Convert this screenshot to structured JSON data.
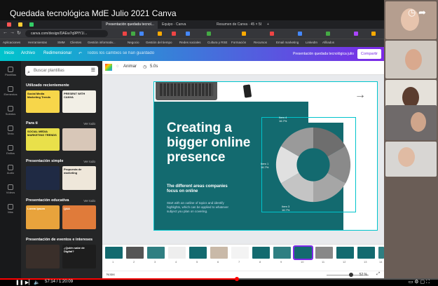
{
  "video": {
    "title": "Quedada tecnológica MdE Julio 2021 Canva",
    "time": "57:14 / 1:20:09",
    "progress_percent": 54
  },
  "browser": {
    "tabs": [
      "Presentación quedada tecnol...",
      "Equipo · Canva",
      "Resumen de Canva · 45 × 58 ·",
      "+"
    ],
    "url": "canva.com/design/DAEw7q9PfY1/...",
    "bookmarks": [
      "Aplicaciones",
      "Herramientas",
      "SMM",
      "Clientes",
      "Gestión informativ...",
      "Negocio",
      "Gestión del tiempo",
      "Redes sociales",
      "Cultura y RSE",
      "Formación",
      "Recursos",
      "Email marketing",
      "LinkedIn",
      "Afiliados"
    ]
  },
  "canva": {
    "header": {
      "home": "Inicio",
      "file": "Archivo",
      "resize": "Redimensionar",
      "saved": "Todos los cambios se han guardado",
      "doc_title": "Presentación quedada tecnológica julio",
      "share": "Compartir"
    },
    "sidebar": [
      {
        "label": "Plantillas",
        "icon": "template-icon"
      },
      {
        "label": "Elementos",
        "icon": "elements-icon"
      },
      {
        "label": "Subidos",
        "icon": "upload-icon"
      },
      {
        "label": "Texto",
        "icon": "text-icon"
      },
      {
        "label": "Estilos",
        "icon": "styles-icon"
      },
      {
        "label": "Audio",
        "icon": "audio-icon"
      },
      {
        "label": "Vídeos",
        "icon": "video-icon"
      },
      {
        "label": "Más",
        "icon": "more-icon"
      }
    ],
    "panel": {
      "search_placeholder": "Buscar plantillas",
      "see_all": "Ver todo",
      "sections": [
        {
          "title": "Utilizado recientemente",
          "thumbs": [
            "Social Media Marketing Trends",
            "PRESENT WITH CANVA"
          ]
        },
        {
          "title": "Para ti",
          "thumbs": [
            "SOCIAL MEDIA MARKETING TRENDS",
            ""
          ]
        },
        {
          "title": "Presentación simple",
          "thumbs": [
            "",
            "Propuesta de marketing"
          ]
        },
        {
          "title": "Presentación educativa",
          "thumbs": [
            "Lorem Ipsum",
            "Q&A"
          ]
        },
        {
          "title": "Presentación de eventos e intereses",
          "thumbs": [
            "",
            "¿Quién sabe de Digital?"
          ]
        }
      ]
    },
    "editor": {
      "animate": "Animar",
      "duration": "5.0s"
    },
    "slide": {
      "title": "Creating a bigger online presence",
      "subtitle": "The different areas companies focus on online",
      "body": "Start with an outline of topics and identify highlights, which can be applied to whatever subject you plan on covering.",
      "donut_labels": [
        "Item 4\n16.7%",
        "Item 1\n16.7%",
        "Item 3\n16.7%"
      ]
    },
    "notes": "Notas",
    "zoom": "52 %",
    "page_numbers": [
      "1",
      "2",
      "3",
      "4",
      "5",
      "6",
      "7",
      "8",
      "9",
      "10",
      "11",
      "12",
      "13",
      "14"
    ]
  },
  "colors": {
    "teal": "#136a6f",
    "accent": "#00c4cc",
    "purple": "#7d2ae8"
  }
}
